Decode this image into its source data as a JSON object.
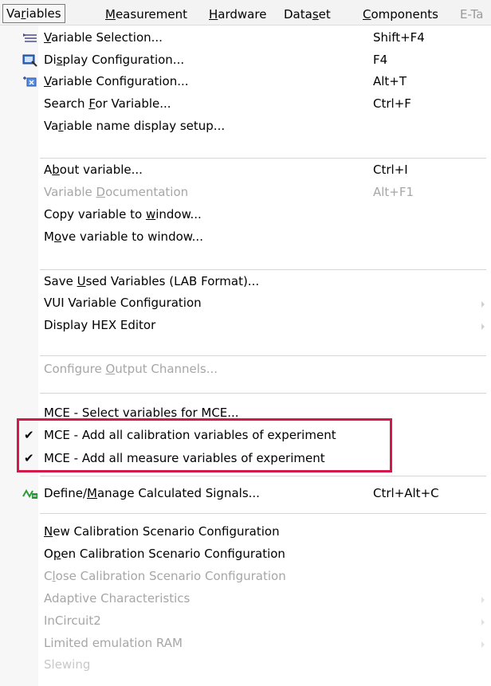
{
  "menubar": [
    {
      "label": "Variables",
      "mn": "r",
      "pre": "Va",
      "post": "iables",
      "active": true
    },
    {
      "label": "Measurement",
      "mn": "M",
      "pre": "",
      "post": "easurement"
    },
    {
      "label": "Hardware",
      "mn": "H",
      "pre": "",
      "post": "ardware"
    },
    {
      "label": "Dataset",
      "mn": "s",
      "pre": "Data",
      "post": "et"
    },
    {
      "label": "Components",
      "mn": "C",
      "pre": "",
      "post": "omponents"
    },
    {
      "label": "E-Ta",
      "mn": "",
      "pre": "E-Ta",
      "post": "",
      "faded": true
    }
  ],
  "menu": {
    "items": [
      {
        "pre": "",
        "mn": "V",
        "post": "ariable Selection...",
        "shortcut": "Shift+F4",
        "icon": "variable-selection-icon"
      },
      {
        "pre": "Di",
        "mn": "s",
        "post": "play Configuration...",
        "shortcut": "F4",
        "icon": "display-configuration-icon"
      },
      {
        "pre": "",
        "mn": "V",
        "post": "ariable Configuration...",
        "shortcut": "Alt+T",
        "icon": "variable-configuration-icon"
      },
      {
        "pre": "Search ",
        "mn": "F",
        "post": "or Variable...",
        "shortcut": "Ctrl+F"
      },
      {
        "pre": "Va",
        "mn": "r",
        "post": "iable name display setup..."
      },
      {
        "pre": "A",
        "mn": "b",
        "post": "out variable...",
        "shortcut": "Ctrl+I"
      },
      {
        "pre": "Variable ",
        "mn": "D",
        "post": "ocumentation",
        "shortcut": "Alt+F1",
        "disabled": true
      },
      {
        "pre": "Copy variable to ",
        "mn": "w",
        "post": "indow..."
      },
      {
        "pre": "M",
        "mn": "o",
        "post": "ve variable to window..."
      },
      {
        "pre": "Save ",
        "mn": "U",
        "post": "sed Variables (LAB Format)..."
      },
      {
        "pre": "VUI Variable Configuration",
        "mn": "",
        "post": "",
        "submenu": true
      },
      {
        "pre": "Display HEX Editor",
        "mn": "",
        "post": "",
        "submenu": true
      },
      {
        "pre": "Configure ",
        "mn": "O",
        "post": "utput Channels...",
        "disabled": true
      },
      {
        "pre": "MCE - Select variables for MCE...",
        "mn": "",
        "post": ""
      },
      {
        "pre": "MCE - Add all calibration variables of experiment",
        "mn": "",
        "post": "",
        "checked": true
      },
      {
        "pre": "MCE - Add all measure variables of experiment",
        "mn": "",
        "post": "",
        "checked": true
      },
      {
        "pre": "Define/",
        "mn": "M",
        "post": "anage Calculated Signals...",
        "shortcut": "Ctrl+Alt+C",
        "icon": "calculated-signals-icon"
      },
      {
        "pre": "",
        "mn": "N",
        "post": "ew Calibration Scenario Configuration"
      },
      {
        "pre": "O",
        "mn": "p",
        "post": "en Calibration Scenario Configuration"
      },
      {
        "pre": "C",
        "mn": "l",
        "post": "ose Calibration Scenario Configuration",
        "disabled": true
      },
      {
        "pre": "Adaptive Characteristics",
        "mn": "",
        "post": "",
        "disabled": true,
        "submenu": true
      },
      {
        "pre": "InCircuit2",
        "mn": "",
        "post": "",
        "disabled": true,
        "submenu": true
      },
      {
        "pre": "Limited emulation RAM",
        "mn": "",
        "post": "",
        "disabled": true,
        "submenu": true
      },
      {
        "pre": "Slewing",
        "mn": "",
        "post": "",
        "faded": true
      }
    ],
    "check_glyph": "✔",
    "highlight_color": "#d2194a"
  }
}
